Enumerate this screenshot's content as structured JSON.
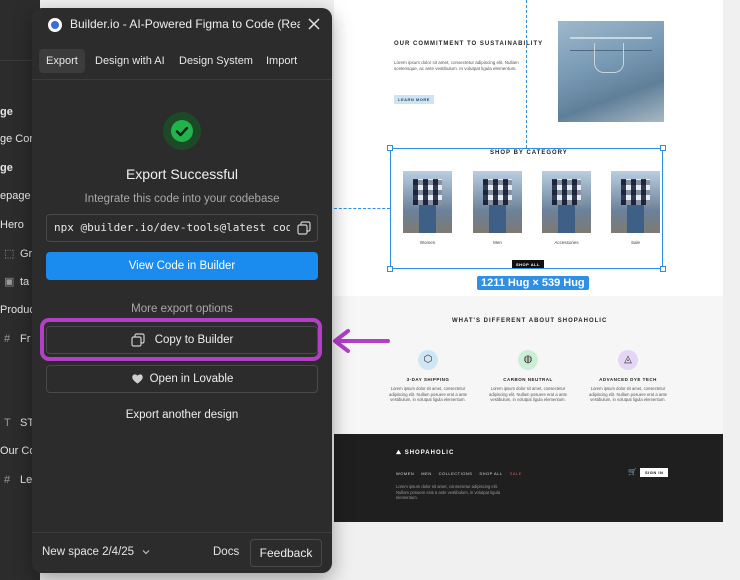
{
  "layers": {
    "items": [
      {
        "glyph": "",
        "label": "ge",
        "bold": true
      },
      {
        "glyph": "",
        "label": "ge Cont",
        "bold": false
      },
      {
        "glyph": "",
        "label": "ge",
        "bold": true
      },
      {
        "glyph": "",
        "label": "epage",
        "bold": false
      },
      {
        "glyph": "",
        "label": "Hero",
        "bold": false
      },
      {
        "glyph": "⬚",
        "label": "Gr",
        "bold": false
      },
      {
        "glyph": "▣",
        "label": "ta",
        "bold": false
      },
      {
        "glyph": "",
        "label": "Produc",
        "bold": false
      },
      {
        "glyph": "#",
        "label": "Fr",
        "bold": false
      },
      {
        "glyph": "T",
        "label": "ST",
        "bold": false
      },
      {
        "glyph": "",
        "label": "Our Co",
        "bold": false
      },
      {
        "glyph": "#",
        "label": "Le",
        "bold": false
      }
    ]
  },
  "site": {
    "sustainability": {
      "title": "OUR COMMITMENT TO SUSTAINABILITY",
      "body": "Lorem ipsum dolor sit amet, consectetur adipiscing elit. Nullam scelerisque, ac ante vestibulum. In volutpat ligula elementum.",
      "button": "LEARN MORE"
    },
    "category": {
      "title": "SHOP BY CATEGORY",
      "labels": [
        "Women",
        "Men",
        "Accessories",
        "Sale"
      ],
      "button": "SHOP ALL"
    },
    "different": {
      "title": "WHAT'S DIFFERENT ABOUT SHOPAHOLIC",
      "features": [
        {
          "title": "3-DAY SHIPPING",
          "text": "Lorem ipsum dolor sit amet, consectetur adipiscing elit. Nullam posuere erat a ante vestibulum, in volutpat ligula elementum.",
          "color": "#cfe6f5",
          "icon": "box-icon"
        },
        {
          "title": "CARBON NEUTRAL",
          "text": "Lorem ipsum dolor sit amet, consectetur adipiscing elit. Nullam posuere erat a ante vestibulum, in volutpat ligula elementum.",
          "color": "#cdeed6",
          "icon": "globe-icon"
        },
        {
          "title": "ADVANCED DYE TECH",
          "text": "Lorem ipsum dolor sit amet, consectetur adipiscing elit. Nullam posuere erat a ante vestibulum, in volutpat ligula elementum.",
          "color": "#e4d6f4",
          "icon": "droplet-icon"
        }
      ]
    },
    "footer": {
      "brand": "SHOPAHOLIC",
      "nav": [
        "WOMEN",
        "MEN",
        "COLLECTIONS",
        "SHOP ALL"
      ],
      "sale": "SALE",
      "body": "Lorem ipsum dolor sit amet, consectetur adipiscing elit. Nullam posuere erat a ante vestibulum, in volutpat ligula elementum.",
      "signin": "SIGN IN"
    }
  },
  "selection": {
    "dimensions": "1211 Hug × 539 Hug"
  },
  "plugin": {
    "title": "Builder.io - AI-Powered Figma to Code (React, Vue, Tailwind & more)",
    "tabs": [
      {
        "label": "Export",
        "active": true
      },
      {
        "label": "Design with AI",
        "active": false
      },
      {
        "label": "Design System",
        "active": false
      },
      {
        "label": "Import",
        "active": false
      }
    ],
    "headline": "Export Successful",
    "subline": "Integrate this code into your codebase",
    "command": "npx @builder.io/dev-tools@latest code",
    "view_button": "View Code in Builder",
    "more_label": "More export options",
    "copy_button": "Copy to Builder",
    "lovable_button": "Open in Lovable",
    "export_another": "Export another design",
    "space_label": "New space 2/4/25",
    "docs_link": "Docs",
    "feedback_button": "Feedback"
  },
  "colors": {
    "accent_blue": "#1a8cf0",
    "success_green": "#22b34d",
    "annotation_purple": "#b33fc9",
    "selection_blue": "#2f8fe2",
    "panel_bg": "#2c2c2c"
  }
}
